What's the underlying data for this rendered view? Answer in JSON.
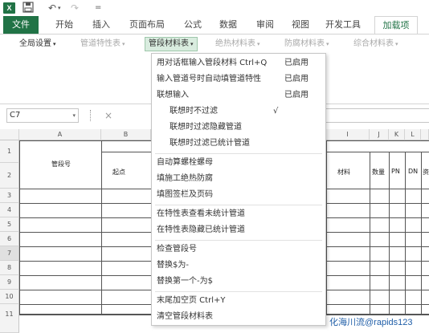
{
  "qat": {
    "logo": "X",
    "save_icon": "floppy-disk-icon",
    "undo_glyph": "↶",
    "redo_glyph": "↷",
    "more_glyph": "="
  },
  "tabs": [
    {
      "label": "文件"
    },
    {
      "label": "开始"
    },
    {
      "label": "插入"
    },
    {
      "label": "页面布局"
    },
    {
      "label": "公式"
    },
    {
      "label": "数据"
    },
    {
      "label": "审阅"
    },
    {
      "label": "视图"
    },
    {
      "label": "开发工具"
    },
    {
      "label": "加载项"
    }
  ],
  "toolbar": {
    "items": [
      {
        "label": "全局设置"
      },
      {
        "label": "管道特性表"
      },
      {
        "label": "管段材料表"
      },
      {
        "label": "绝热材料表"
      },
      {
        "label": "防腐材料表"
      },
      {
        "label": "综合材料表"
      }
    ]
  },
  "formula": {
    "namebox": "C7",
    "cancel_glyph": "×"
  },
  "sheet": {
    "columns": [
      "A",
      "B",
      "I",
      "J",
      "K",
      "L"
    ],
    "rows": [
      "1",
      "2",
      "3",
      "4",
      "5",
      "6",
      "7",
      "8",
      "9",
      "10",
      "11"
    ],
    "header_pipe_no": "管段号",
    "header_start": "起点",
    "header_material": "材料",
    "header_qty": "数量",
    "header_pn": "PN",
    "header_dn": "DN",
    "header_extra": "资"
  },
  "menu": {
    "items": [
      {
        "label": "用对话框输入管段材料 Ctrl+Q",
        "status": "已启用"
      },
      {
        "label": "输入管道号时自动填管道特性",
        "status": "已启用"
      },
      {
        "label": "联想输入",
        "status": "已启用"
      },
      {
        "label": "联想时不过滤",
        "check": "√"
      },
      {
        "label": "联想时过滤隐藏管道"
      },
      {
        "label": "联想时过滤已统计管道"
      },
      {
        "label": "自动算螺栓螺母"
      },
      {
        "label": "填施工绝热防腐"
      },
      {
        "label": "填图签栏及页码"
      },
      {
        "label": "在特性表查看未统计管道"
      },
      {
        "label": "在特性表隐藏已统计管道"
      },
      {
        "label": "检查管段号"
      },
      {
        "label": "替换$为-"
      },
      {
        "label": "替换第一个-为$"
      },
      {
        "label": "末尾加空页 Ctrl+Y"
      },
      {
        "label": "清空管段材料表"
      }
    ]
  },
  "watermark": "化海川流@rapids123",
  "colors": {
    "accent": "#217346",
    "pressed_bg": "#d9ecdf"
  }
}
